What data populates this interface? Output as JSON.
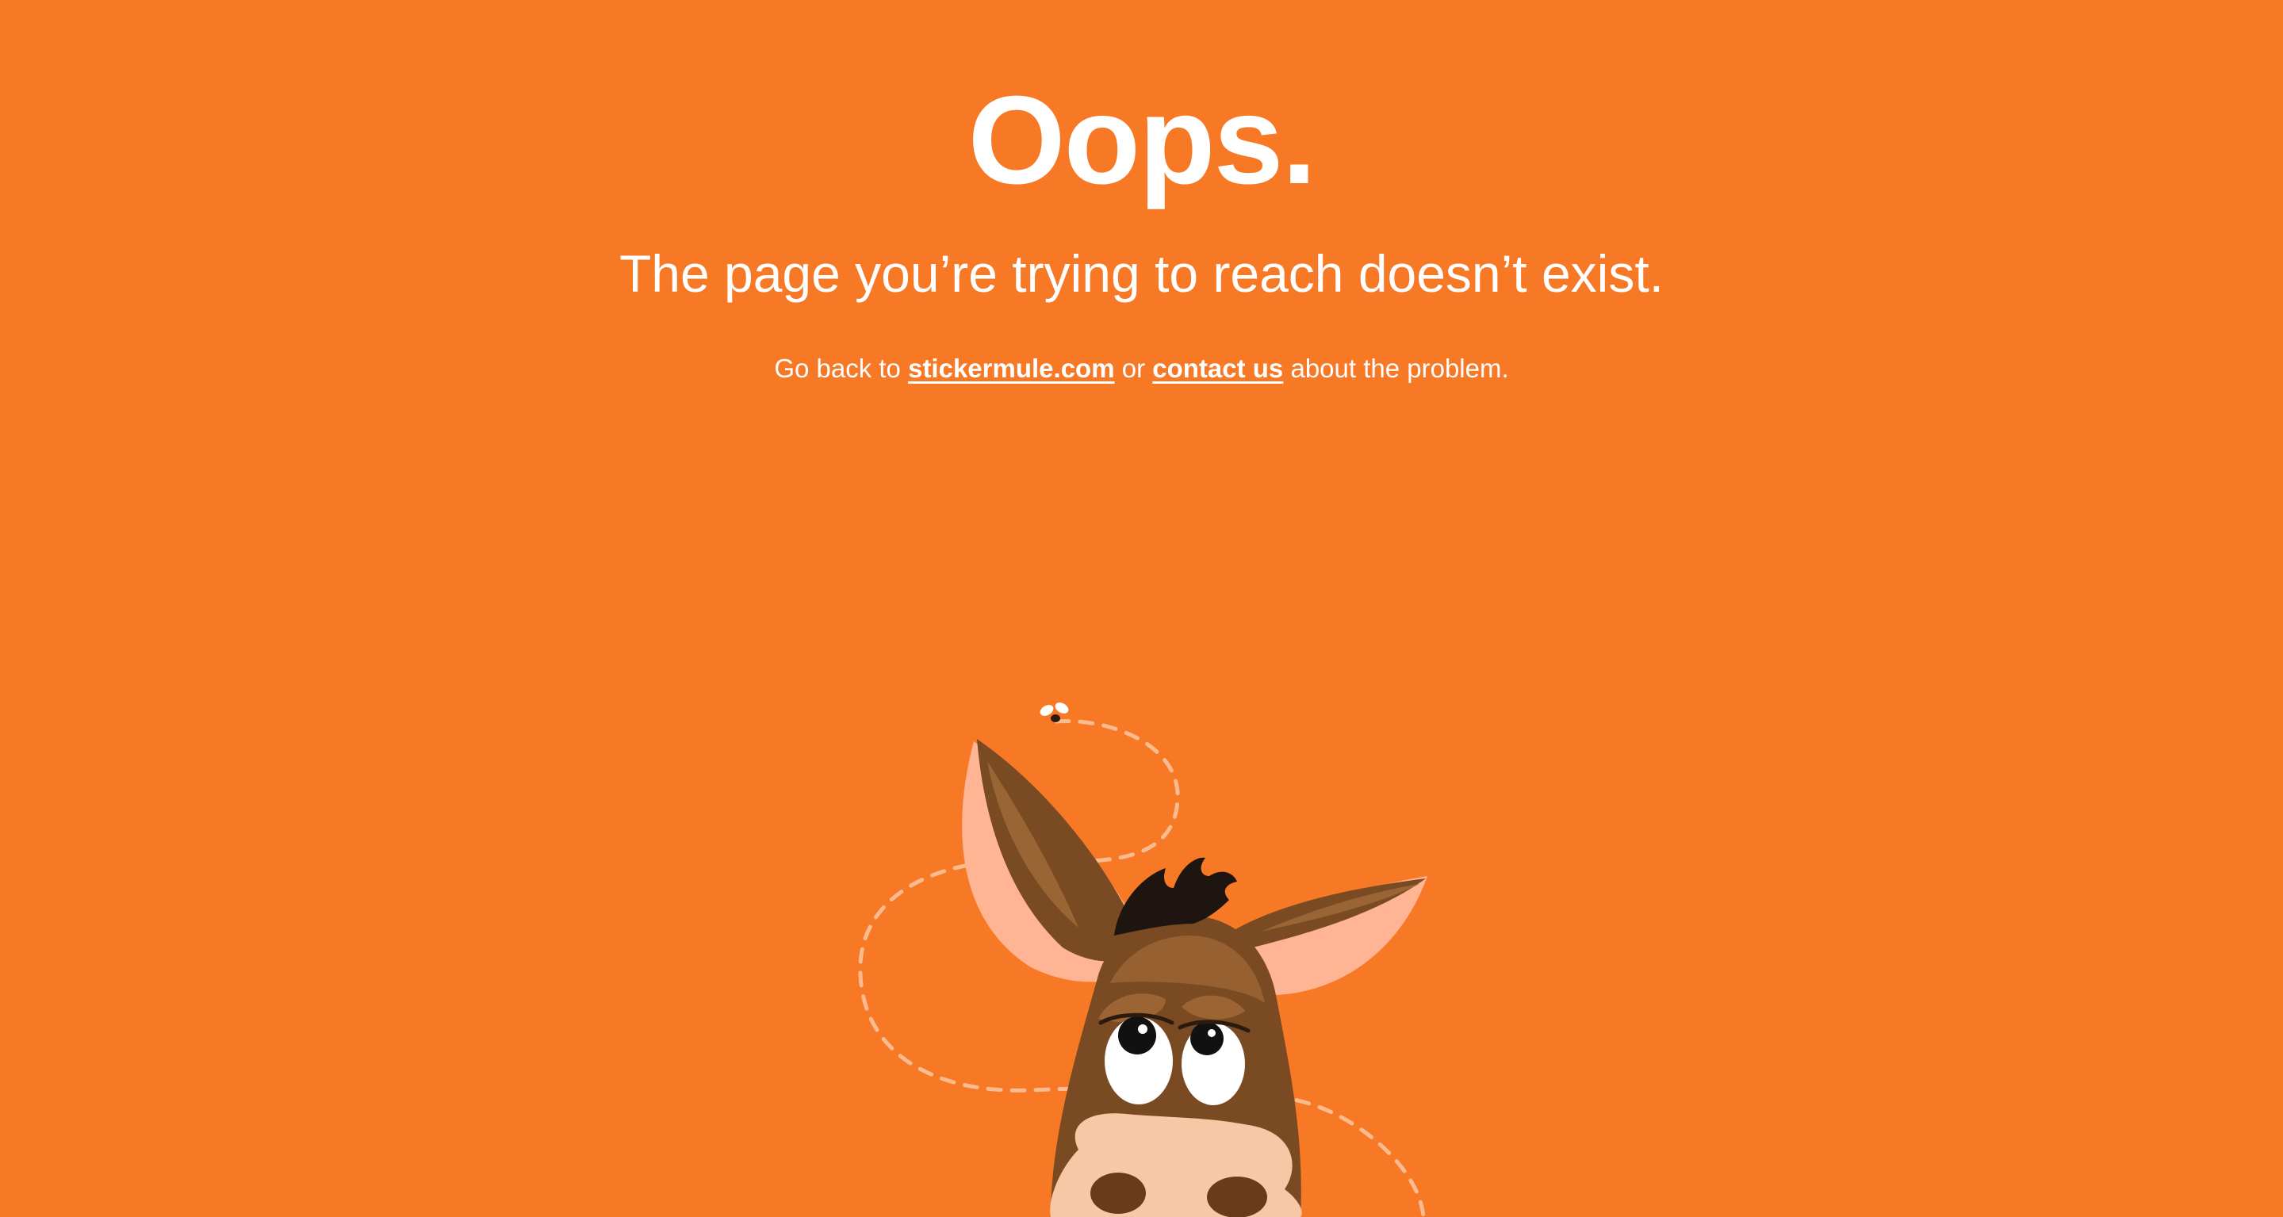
{
  "error": {
    "title": "Oops.",
    "subtitle": "The page you’re trying to reach doesn’t exist.",
    "help_prefix": "Go back to",
    "home_link_label": "stickermule.com",
    "help_middle": "or",
    "contact_link_label": "contact us",
    "help_suffix": "about the problem."
  },
  "colors": {
    "background": "#F77926",
    "text": "#FFFFFF",
    "mule_brown": "#7A4A22",
    "mule_light": "#A8703C",
    "ear_inner": "#FFB494",
    "muzzle": "#F7C7A6",
    "hair": "#1E1410"
  },
  "illustration": {
    "icon": "mule-mascot-icon",
    "fly_icon": "fly-icon"
  }
}
